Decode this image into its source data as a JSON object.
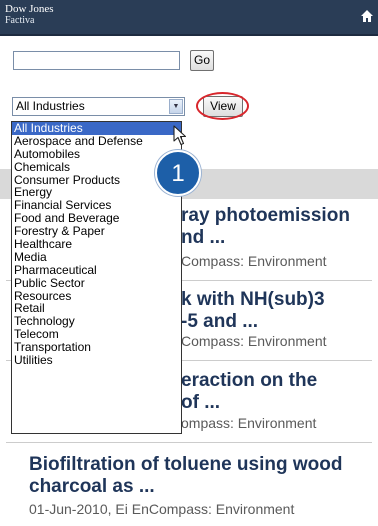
{
  "header": {
    "logo_line1": "Dow Jones",
    "logo_line2": "Factiva",
    "home_icon": "home-icon",
    "background": "#2a3d56"
  },
  "search": {
    "value": "",
    "go_label": "Go"
  },
  "filter": {
    "selected": "All Industries",
    "view_label": "View",
    "options": [
      "All Industries",
      "Aerospace and Defense",
      "Automobiles",
      "Chemicals",
      "Consumer Products",
      "Energy",
      "Financial Services",
      "Food and Beverage",
      "Forestry & Paper",
      "Healthcare",
      "Media",
      "Pharmaceutical",
      "Public Sector",
      "Resources",
      "Retail",
      "Technology",
      "Telecom",
      "Transportation",
      "Utilities"
    ]
  },
  "callout": {
    "step": "1",
    "color": "#d8262c"
  },
  "results": [
    {
      "title_line1": "ray photoemission",
      "title_line2": "nd ...",
      "meta": "Compass: Environment"
    },
    {
      "title_line1": "k with NH(sub)3",
      "title_line2": "-5 and ...",
      "meta": "Compass: Environment"
    },
    {
      "title_line1": "eraction on the",
      "title_line2": "of ...",
      "meta": "ompass: Environment"
    },
    {
      "title_line1": "Biofiltration of toluene using wood",
      "title_line2": "charcoal as ...",
      "meta": "01-Jun-2010, Ei EnCompass: Environment"
    }
  ]
}
